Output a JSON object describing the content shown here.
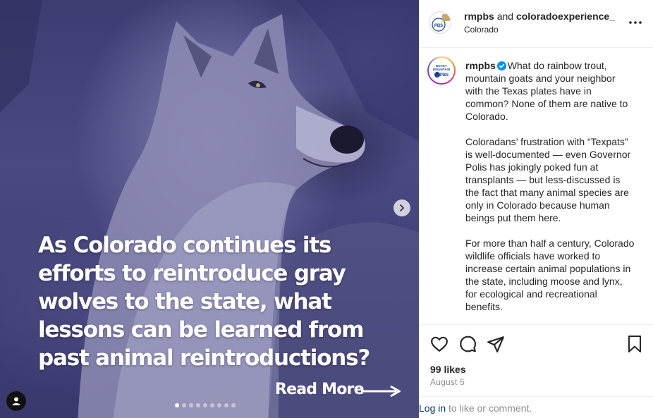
{
  "media": {
    "headline": "As Colorado continues its efforts to reintroduce gray wolves to the state, what lessons can be learned from past animal reintroductions?",
    "read_more": "Read More",
    "carousel_total": 9,
    "carousel_active": 1,
    "next_icon": "chevron-right-icon",
    "tag_icon": "user-tag-icon"
  },
  "header": {
    "account1": "rmpbs",
    "and_text": "and",
    "account2": "coloradoexperience_",
    "location": "Colorado",
    "more_icon": "more-horizontal-icon"
  },
  "caption": {
    "username": "rmpbs",
    "verified_icon": "verified-badge-icon",
    "paragraph1": "What do rainbow trout, mountain goats and your neighbor with the Texas plates have in common? None of them are native to Colorado.",
    "paragraph2": "Coloradans’ frustration with “Texpats” is well-documented — even Governor Polis has jokingly poked fun at transplants — but less-discussed is the fact that many animal species are only in Colorado because human beings put them here.",
    "paragraph3": "For more than half a century, Colorado wildlife officials have worked to increase certain animal populations in the state, including moose and lynx, for ecological and recreational benefits."
  },
  "actions": {
    "like_icon": "heart-icon",
    "comment_icon": "comment-icon",
    "share_icon": "share-icon",
    "save_icon": "bookmark-icon"
  },
  "stats": {
    "likes": "99 likes",
    "date": "August 5"
  },
  "login": {
    "link": "Log in",
    "rest": "to like or comment."
  },
  "colors": {
    "media_tint": "#4a4982",
    "link": "#00376b",
    "verified": "#0095f6"
  }
}
